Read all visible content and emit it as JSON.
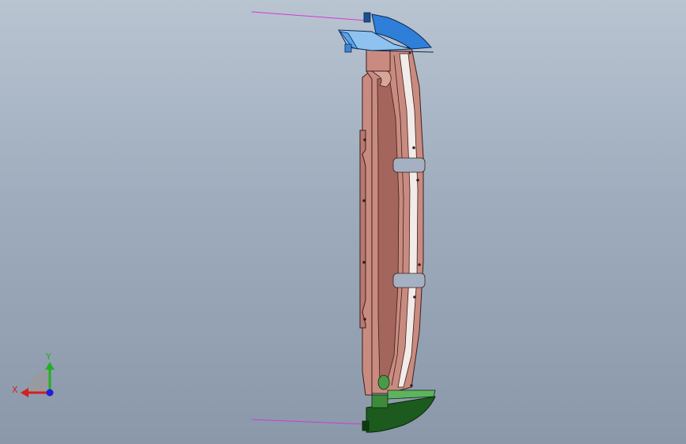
{
  "viewport": {
    "background_top": "#b9c4d1",
    "background_bottom": "#8a98aa"
  },
  "triad": {
    "x_label": "X",
    "y_label": "Y",
    "x_color": "#d42020",
    "y_color": "#22b022",
    "z_color": "#2020d8"
  },
  "colors": {
    "body": "#c98b80",
    "body_shadow": "#a4655c",
    "body_edge": "#3a1f1c",
    "rail_light": "#f2ebe8",
    "top_cap": "#2f7fd8",
    "top_cap_light": "#8ec3f0",
    "bottom_cap": "#1d5a1d",
    "bottom_cap_light": "#5fb35f",
    "leader_line": "#d23ad2",
    "slot_fill": "#a5b1c2"
  }
}
